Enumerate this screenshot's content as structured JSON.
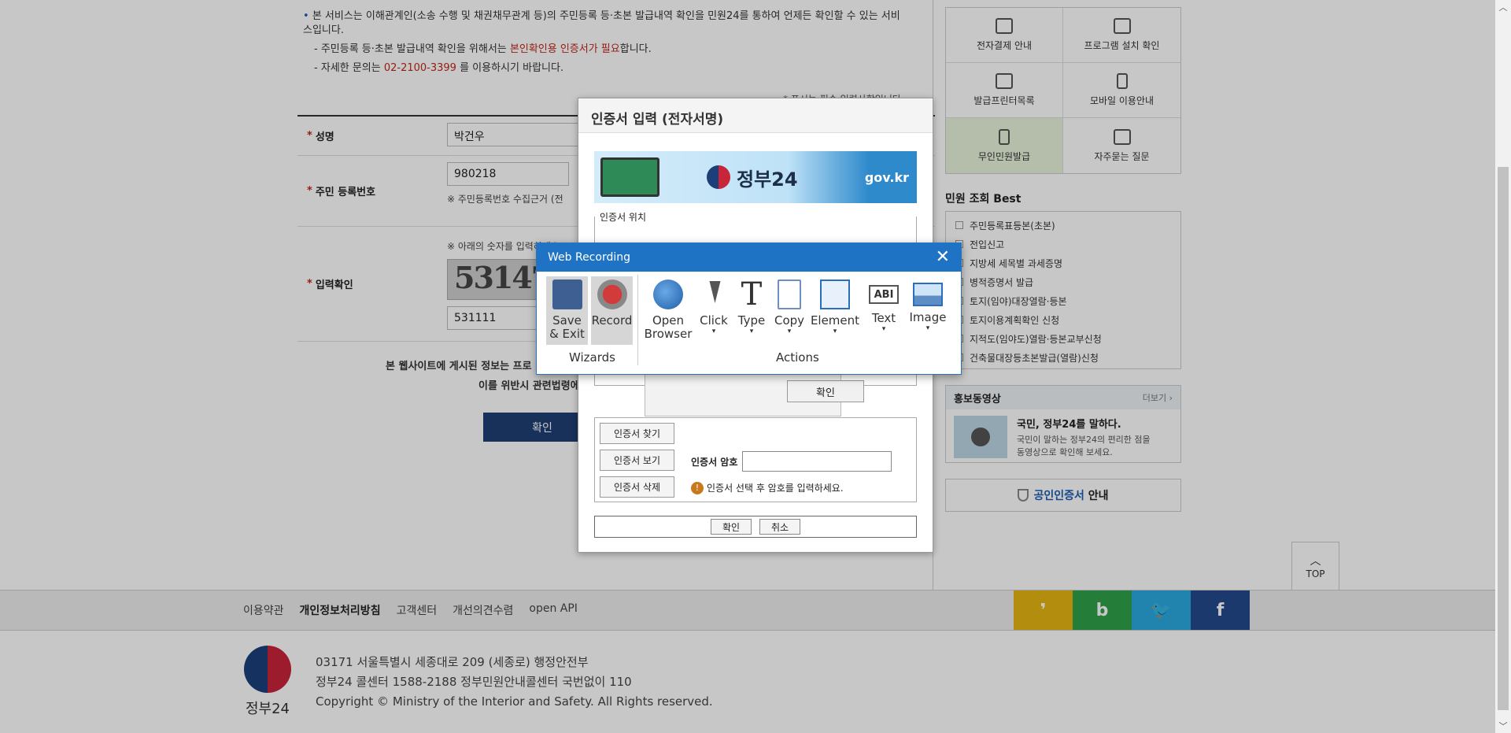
{
  "notice": {
    "line1": "본 서비스는 이해관계인(소송 수행 및 채권채무관계 등)의 주민등록 등·초본 발급내역 확인을 민원24를 통하여 언제든 확인할 수 있는 서비스입니다.",
    "line2_prefix": "- 주민등록 등·초본 발급내역 확인을 위해서는 ",
    "line2_red": "본인확인용 인증서가 필요",
    "line2_suffix": "합니다.",
    "line3_prefix": "- 자세한 문의는 ",
    "line3_red": "02-2100-3399",
    "line3_suffix": " 를 이용하시기 바랍니다.",
    "required_note": "* 표시는 필수 입력사항입니다"
  },
  "form": {
    "name_label": "성명",
    "name_value": "박건우",
    "rrn_label": "주민 등록번호",
    "rrn_value": "980218",
    "rrn_note": "※ 주민등록번호 수집근거 (전",
    "captcha_label": "입력확인",
    "captcha_note": "※ 아래의 숫자를 입력하세요",
    "captcha_image_text": "531470",
    "captcha_value": "531111"
  },
  "warning": {
    "line1": "본 웹사이트에 게시된 정보는 프로",
    "line2": "이를 위반시 관련법령에"
  },
  "confirm_button": "확인",
  "sidebar": {
    "tiles": [
      {
        "label": "전자결제 안내",
        "icon": "download-icon"
      },
      {
        "label": "프로그램 설치 확인",
        "icon": "monitor-check-icon"
      },
      {
        "label": "발급프린터목록",
        "icon": "printer-icon"
      },
      {
        "label": "모바일 이용안내",
        "icon": "mobile-icon"
      },
      {
        "label": "무인민원발급",
        "icon": "kiosk-icon"
      },
      {
        "label": "자주묻는 질문",
        "icon": "chat-icon"
      }
    ],
    "best_title": "민원 조회 Best",
    "best_items": [
      "주민등록표등본(초본)",
      "전입신고",
      "지방세 세목별 과세증명",
      "병적증명서 발급",
      "토지(임야)대장열람·등본",
      "토지이용계획확인 신청",
      "지적도(임야도)열람·등본교부신청",
      "건축물대장등초본발급(열람)신청"
    ],
    "promo_title": "홍보동영상",
    "promo_more": "더보기 ›",
    "promo_headline": "국민, 정부24를 말하다.",
    "promo_desc_1": "국민이 말하는 정부24의 편리한 점을",
    "promo_desc_2": "동영상으로 확인해 보세요.",
    "cert_info_blue": "공인인증서",
    "cert_info_rest": " 안내"
  },
  "top_button": "TOP",
  "footer": {
    "links": [
      "이용약관",
      "개인정보처리방침",
      "고객센터",
      "개선의견수렴",
      "open API"
    ],
    "address": "03171 서울특별시 세종대로 209 (세종로) 행정안전부",
    "callcenter": "정부24 콜센터 1588-2188 정부민원안내콜센터 국번없이 110",
    "copyright": "Copyright © Ministry of the Interior and Safety. All Rights reserved.",
    "logo_text": "정부24",
    "sns": [
      "❜",
      "b",
      "🐦",
      "f"
    ],
    "sns_colors": [
      "#e6b712",
      "#2fa24a",
      "#2aa9e0",
      "#244a8c"
    ]
  },
  "cert_dialog": {
    "title": "인증서 입력 (전자서명)",
    "banner_brand": "정부24",
    "banner_gov": "gov.kr",
    "location_label": "인증서 위치",
    "sub_ok": "확인",
    "btn_find": "인증서 찾기",
    "btn_view": "인증서 보기",
    "btn_delete": "인증서 삭제",
    "pw_label": "인증서 암호",
    "pw_hint": "인증서 선택 후 암호를 입력하세요.",
    "ok": "확인",
    "cancel": "취소"
  },
  "web_recording": {
    "title": "Web Recording",
    "wizards": [
      {
        "label": "Save\n& Exit",
        "icon": "floppy-icon"
      },
      {
        "label": "Record",
        "icon": "record-icon"
      }
    ],
    "wizards_label": "Wizards",
    "actions": [
      {
        "label": "Open\nBrowser",
        "icon": "globe-icon"
      },
      {
        "label": "Click",
        "icon": "cursor-icon"
      },
      {
        "label": "Type",
        "icon": "type-icon"
      },
      {
        "label": "Copy",
        "icon": "copy-icon"
      },
      {
        "label": "Element",
        "icon": "element-icon"
      },
      {
        "label": "Text",
        "icon": "text-icon",
        "glyph": "ABI"
      },
      {
        "label": "Image",
        "icon": "image-icon"
      }
    ],
    "actions_label": "Actions"
  }
}
